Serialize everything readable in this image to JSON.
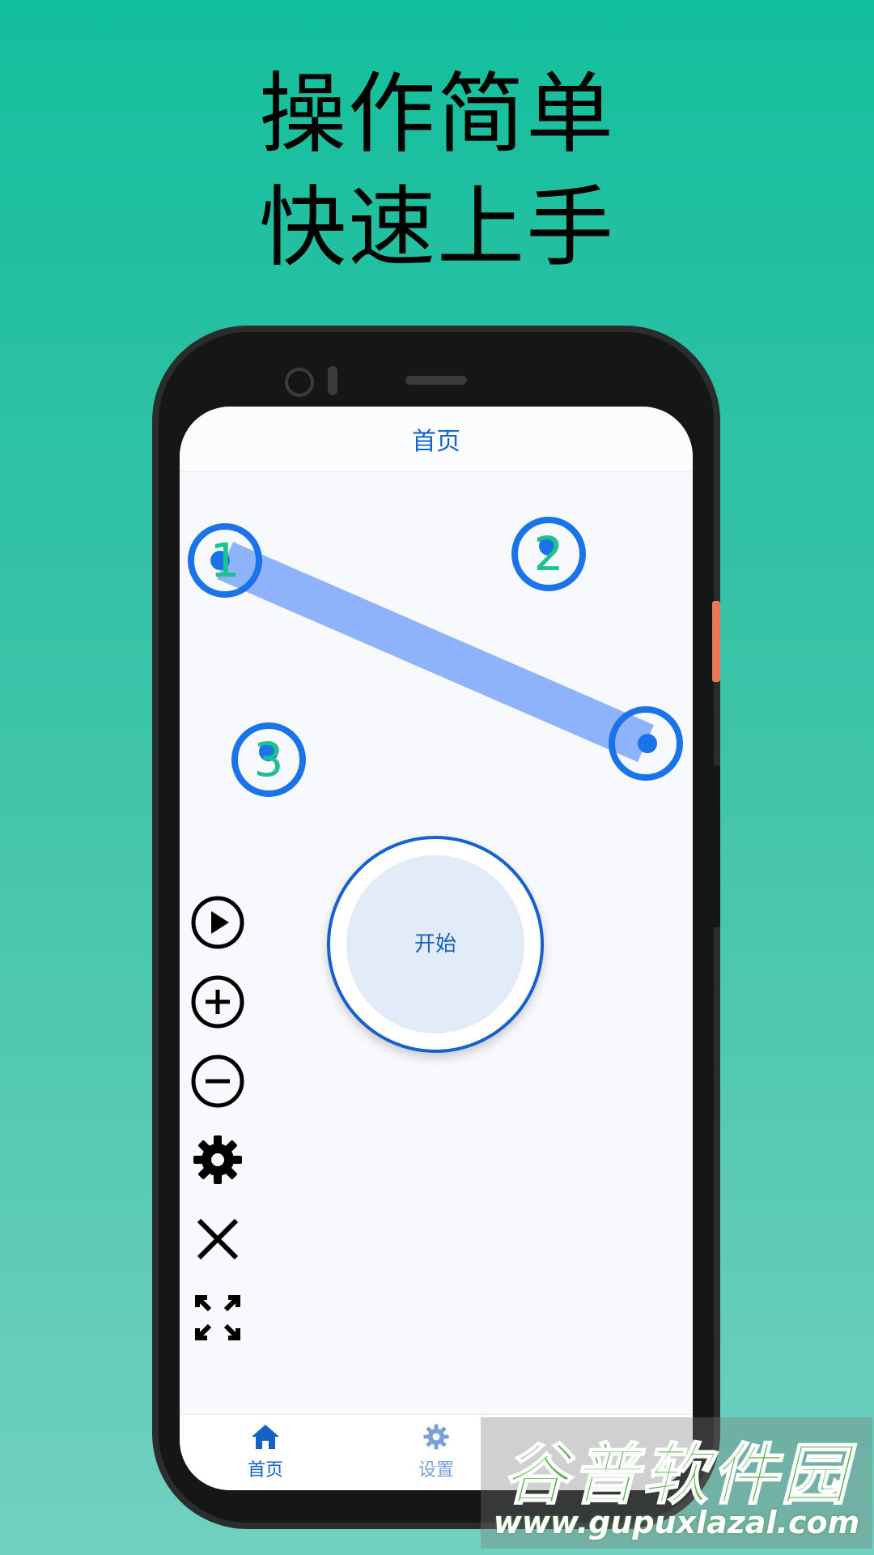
{
  "headline": {
    "line1": "操作简单",
    "line2": "快速上手"
  },
  "app": {
    "title": "首页",
    "points": [
      {
        "label": "1"
      },
      {
        "label": "2"
      },
      {
        "label": "3"
      }
    ],
    "start_button": "开始",
    "toolbar": [
      "play-icon",
      "zoom-in-icon",
      "zoom-out-icon",
      "gear-icon",
      "close-icon",
      "fullscreen-icon"
    ],
    "nav": [
      {
        "label": "首页",
        "icon": "home-icon",
        "active": true
      },
      {
        "label": "设置",
        "icon": "gear-icon",
        "active": false
      }
    ]
  },
  "colors": {
    "accent": "#1463c4",
    "marker_ring": "#1a73e8",
    "number_green": "#1ec28c",
    "swipe_path": "#8fb3fb",
    "background": "#13bf9d"
  },
  "watermark": {
    "title": "谷普软件园",
    "url": "www.gupuxlazal.com"
  }
}
